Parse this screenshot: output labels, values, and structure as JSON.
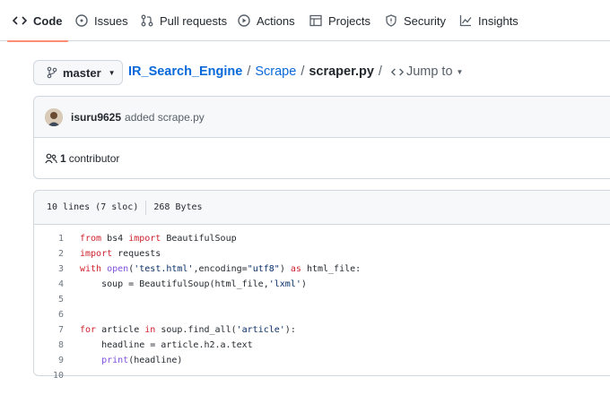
{
  "tabs": [
    {
      "label": "Code",
      "icon": "code-icon",
      "active": true
    },
    {
      "label": "Issues",
      "icon": "issue-icon"
    },
    {
      "label": "Pull requests",
      "icon": "pull-request-icon"
    },
    {
      "label": "Actions",
      "icon": "play-icon"
    },
    {
      "label": "Projects",
      "icon": "table-icon"
    },
    {
      "label": "Security",
      "icon": "shield-icon"
    },
    {
      "label": "Insights",
      "icon": "graph-icon"
    }
  ],
  "branch": {
    "name": "master",
    "icon": "git-branch-icon"
  },
  "breadcrumb": {
    "repo": "IR_Search_Engine",
    "sep1": "/",
    "dir": "Scrape",
    "sep2": "/",
    "file": "scraper.py",
    "sep3": "/",
    "jump_label": "Jump to"
  },
  "commit": {
    "author": "isuru9625",
    "message": "added scrape.py"
  },
  "contributors": {
    "count": "1",
    "label": "contributor",
    "icon": "people-icon"
  },
  "file_info": {
    "lines": "10 lines (7 sloc)",
    "size": "268 Bytes"
  },
  "code_lines": [
    {
      "n": "1",
      "tokens": [
        [
          "kw",
          "from"
        ],
        [
          "t",
          " bs4 "
        ],
        [
          "kw",
          "import"
        ],
        [
          "t",
          " BeautifulSoup"
        ]
      ]
    },
    {
      "n": "2",
      "tokens": [
        [
          "kw",
          "import"
        ],
        [
          "t",
          " requests"
        ]
      ]
    },
    {
      "n": "3",
      "tokens": [
        [
          "kw",
          "with"
        ],
        [
          "t",
          " "
        ],
        [
          "fn",
          "open"
        ],
        [
          "t",
          "("
        ],
        [
          "st",
          "'test.html'"
        ],
        [
          "t",
          ",encoding="
        ],
        [
          "st",
          "\"utf8\""
        ],
        [
          "t",
          ") "
        ],
        [
          "kw",
          "as"
        ],
        [
          "t",
          " html_file:"
        ]
      ]
    },
    {
      "n": "4",
      "tokens": [
        [
          "t",
          "    soup = BeautifulSoup(html_file,"
        ],
        [
          "st",
          "'lxml'"
        ],
        [
          "t",
          ")"
        ]
      ]
    },
    {
      "n": "5",
      "tokens": []
    },
    {
      "n": "6",
      "tokens": []
    },
    {
      "n": "7",
      "tokens": [
        [
          "kw",
          "for"
        ],
        [
          "t",
          " article "
        ],
        [
          "kw",
          "in"
        ],
        [
          "t",
          " soup.find_all("
        ],
        [
          "st",
          "'article'"
        ],
        [
          "t",
          "):"
        ]
      ]
    },
    {
      "n": "8",
      "tokens": [
        [
          "t",
          "    headline = article.h2.a.text"
        ]
      ]
    },
    {
      "n": "9",
      "tokens": [
        [
          "t",
          "    "
        ],
        [
          "fn",
          "print"
        ],
        [
          "t",
          "(headline)"
        ]
      ]
    },
    {
      "n": "10",
      "tokens": []
    }
  ]
}
